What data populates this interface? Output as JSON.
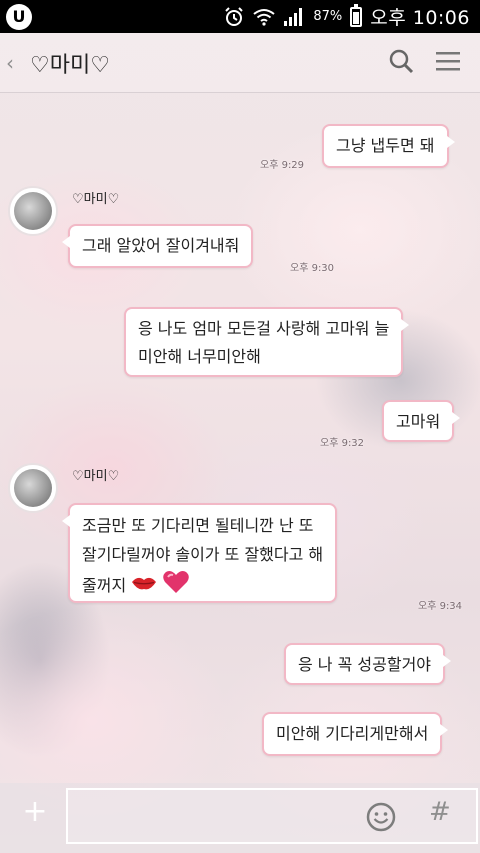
{
  "statusbar": {
    "battery_percent": "87%",
    "clock": "오후 10:06",
    "carrier_logo": "U"
  },
  "header": {
    "title": "♡마미♡"
  },
  "messages": [
    {
      "direction": "out",
      "text_lines": [
        "그냥 냅두면 돼"
      ],
      "time": "오후 9:29"
    },
    {
      "direction": "in",
      "sender": "♡마미♡",
      "text_lines": [
        "그래 알았어 잘이겨내줘"
      ],
      "time": "오후 9:30"
    },
    {
      "direction": "out",
      "text_lines": [
        "응 나도 엄마 모든걸 사랑해 고마워 늘",
        "미안해 너무미안해"
      ],
      "time": ""
    },
    {
      "direction": "out",
      "text_lines": [
        "고마워"
      ],
      "time": "오후 9:32"
    },
    {
      "direction": "in",
      "sender": "♡마미♡",
      "text_lines": [
        "조금만 또 기다리면 될테니깐 난 또",
        "잘기다릴꺼야 솔이가 또 잘했다고 해",
        "줄꺼지"
      ],
      "time": "오후 9:34"
    },
    {
      "direction": "out",
      "text_lines": [
        "응 나 꼭 성공할거야"
      ],
      "time": ""
    },
    {
      "direction": "out",
      "text_lines": [
        "미안해 기다리게만해서"
      ],
      "time": ""
    }
  ],
  "input": {
    "placeholder": ""
  },
  "colors": {
    "bubble_border": "#f2b8c6",
    "statusbar_bg": "#000000"
  },
  "icons": [
    "back-chevron-icon",
    "search-icon",
    "menu-icon",
    "plus-icon",
    "emoji-icon",
    "hash-icon",
    "alarm-icon",
    "wifi-icon",
    "signal-icon",
    "battery-icon",
    "lips-emoji-icon",
    "heart-emoji-icon"
  ]
}
